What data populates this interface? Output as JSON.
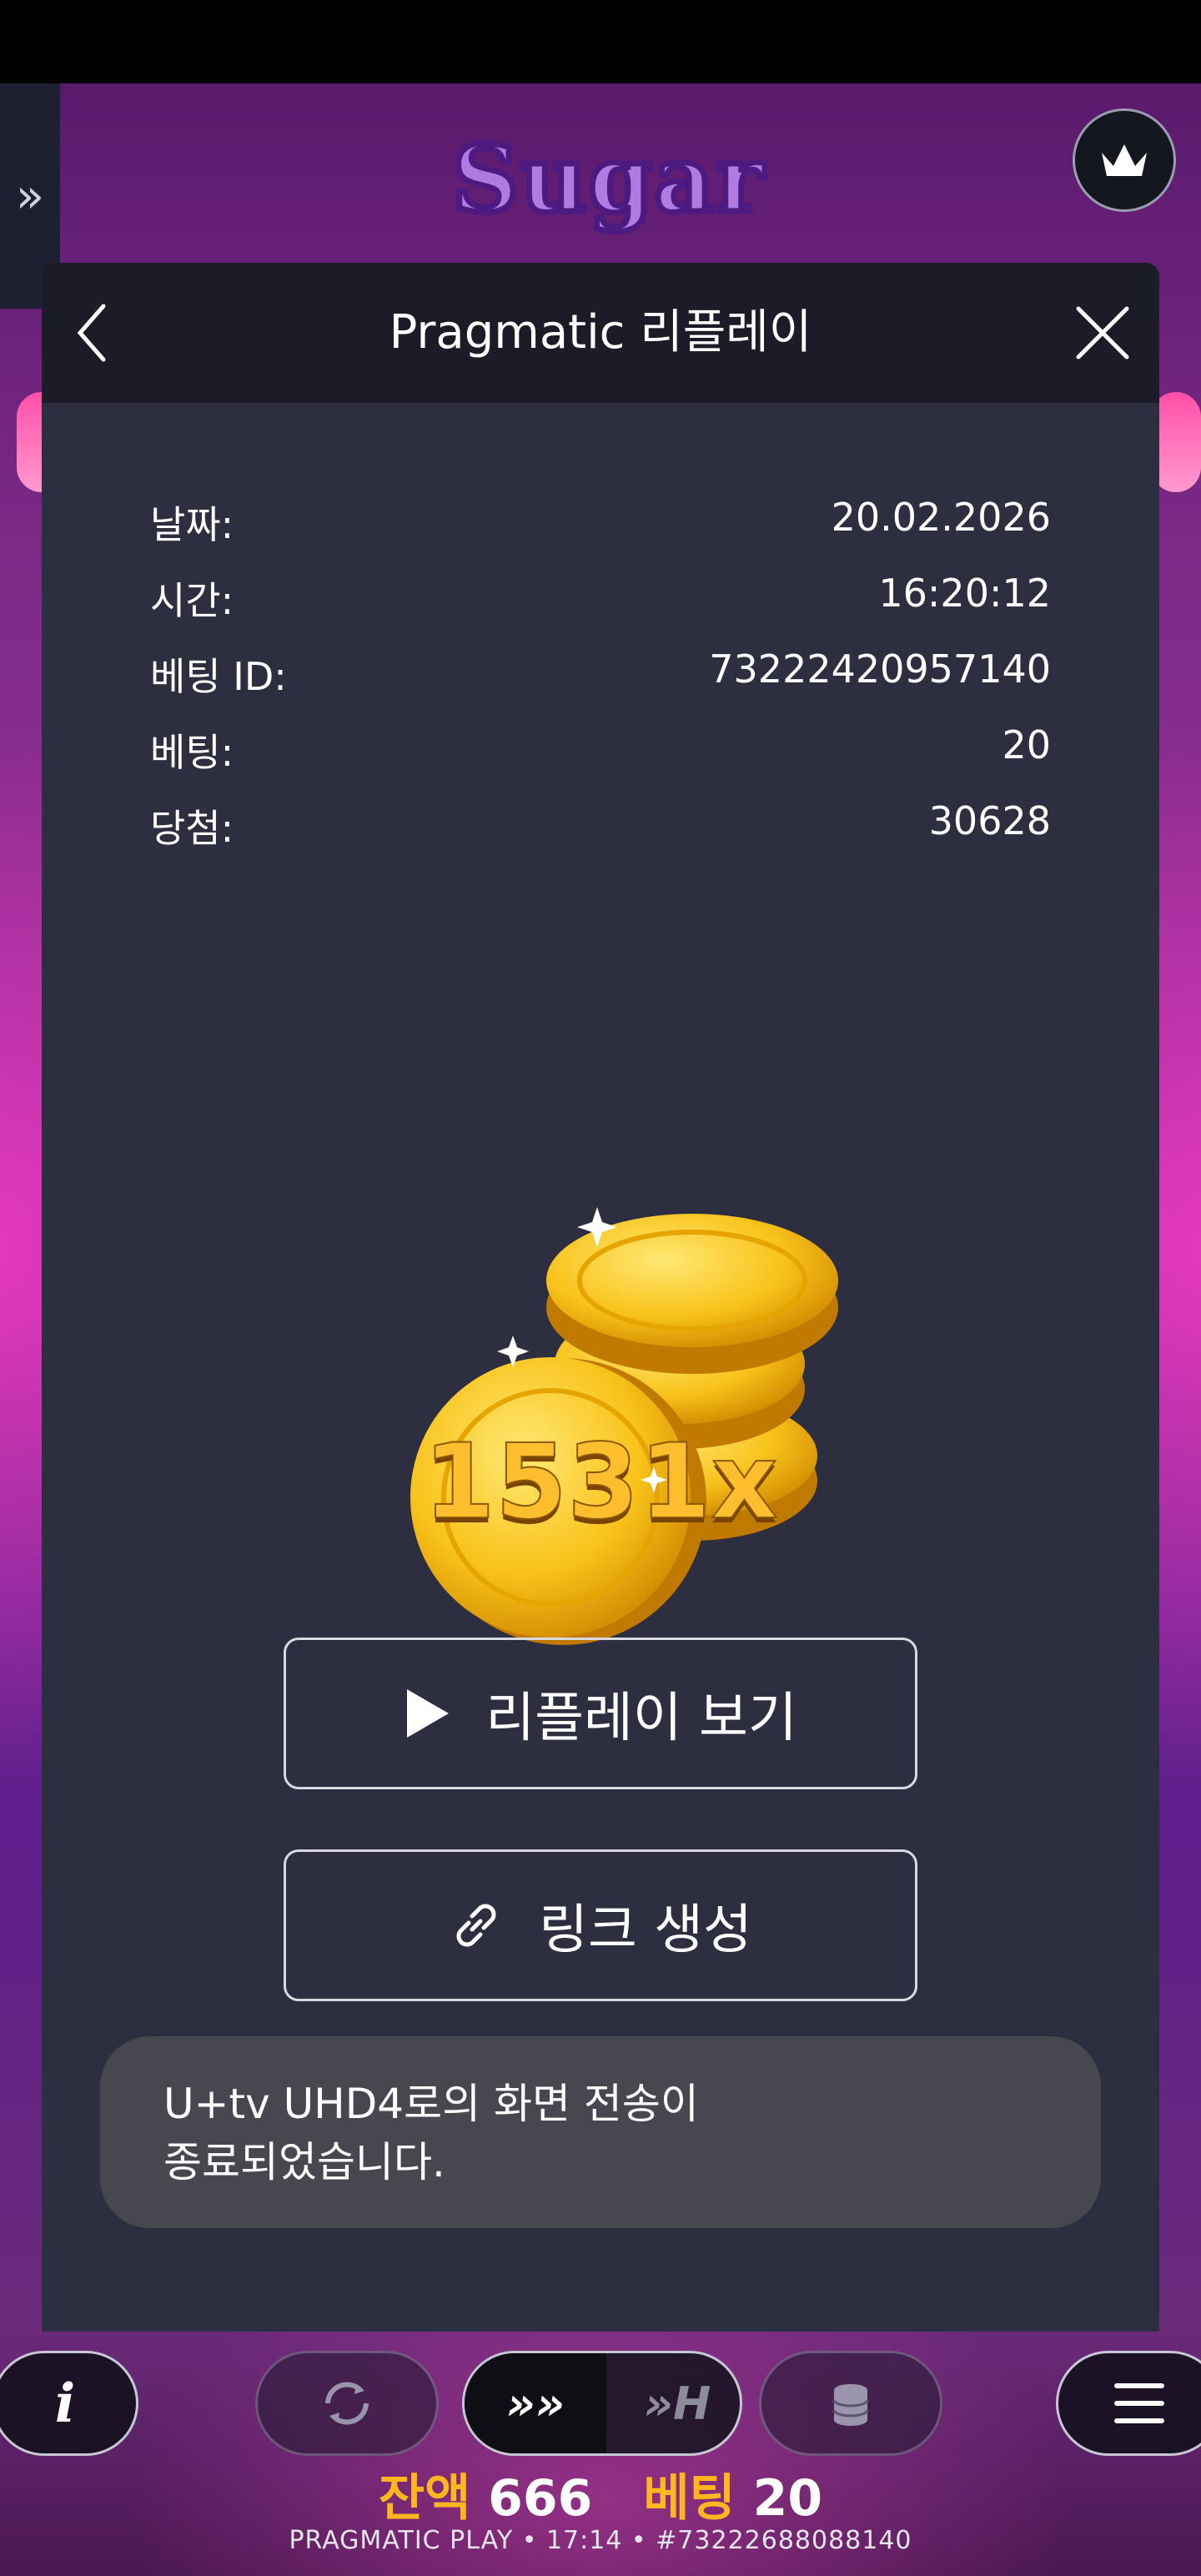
{
  "game": {
    "logo_text": "Sugar"
  },
  "modal": {
    "title": "Pragmatic 리플레이",
    "info": [
      {
        "label": "날짜:",
        "value": "20.02.2026"
      },
      {
        "label": "시간:",
        "value": "16:20:12"
      },
      {
        "label": "베팅 ID:",
        "value": "73222420957140"
      },
      {
        "label": "베팅:",
        "value": "20"
      },
      {
        "label": "당첨:",
        "value": "30628"
      }
    ],
    "multiplier": "1531x",
    "replay_button_label": "리플레이 보기",
    "link_button_label": "링크 생성"
  },
  "toast": {
    "line1": "U+tv UHD4로의 화면 전송이",
    "line2": "종료되었습니다."
  },
  "bottom_bar": {
    "info_label": "i",
    "speed_left": "»»",
    "speed_right": "»H",
    "balance_label": "잔액",
    "balance_value": "666",
    "bet_label": "베팅",
    "bet_value": "20",
    "footer": "PRAGMATIC PLAY • 17:14 • #73222688088140"
  },
  "colors": {
    "modal_bg": "#2d2e3f",
    "header_bg": "#1b1c27",
    "accent_gold": "#ffb61f",
    "toast_bg": "#47484f"
  }
}
